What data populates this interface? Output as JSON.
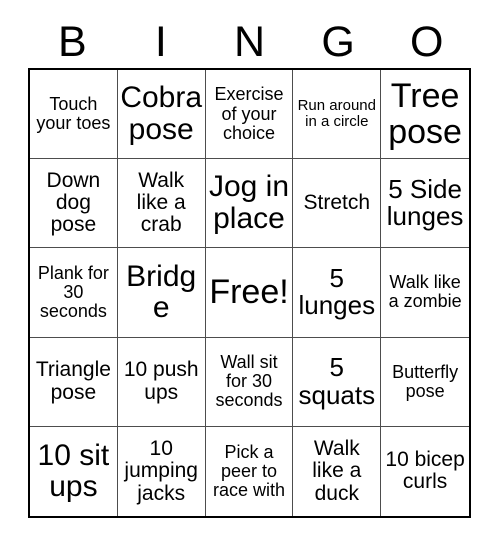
{
  "card": {
    "title_letters": [
      "B",
      "I",
      "N",
      "G",
      "O"
    ],
    "free_space_index": 12,
    "colors": {
      "background": "#ffffff",
      "text": "#000000",
      "outer_border": "#000000",
      "inner_grid_line": "#4d4d4d"
    },
    "grid": {
      "columns": 5,
      "rows": 5
    },
    "cells": [
      {
        "text": "Touch your toes",
        "size": "s"
      },
      {
        "text": "Cobra pose",
        "size": "xl"
      },
      {
        "text": "Exercise of your choice",
        "size": "s"
      },
      {
        "text": "Run around in a circle",
        "size": "xs"
      },
      {
        "text": "Tree pose",
        "size": "xxl"
      },
      {
        "text": "Down dog pose",
        "size": "m"
      },
      {
        "text": "Walk like a crab",
        "size": "m"
      },
      {
        "text": "Jog in place",
        "size": "xl"
      },
      {
        "text": "Stretch",
        "size": "m"
      },
      {
        "text": "5 Side lunges",
        "size": "l"
      },
      {
        "text": "Plank for 30 seconds",
        "size": "s"
      },
      {
        "text": "Bridge",
        "size": "xl"
      },
      {
        "text": "Free!",
        "size": "xxl"
      },
      {
        "text": "5 lunges",
        "size": "l"
      },
      {
        "text": "Walk like a zombie",
        "size": "s"
      },
      {
        "text": "Triangle pose",
        "size": "m"
      },
      {
        "text": "10 push ups",
        "size": "m"
      },
      {
        "text": "Wall sit for 30 seconds",
        "size": "s"
      },
      {
        "text": "5 squats",
        "size": "l"
      },
      {
        "text": "Butterfly pose",
        "size": "s"
      },
      {
        "text": "10 sit ups",
        "size": "xl"
      },
      {
        "text": "10 jumping jacks",
        "size": "m"
      },
      {
        "text": "Pick a peer to race with",
        "size": "s"
      },
      {
        "text": "Walk like a duck",
        "size": "m"
      },
      {
        "text": "10 bicep curls",
        "size": "m"
      }
    ]
  }
}
